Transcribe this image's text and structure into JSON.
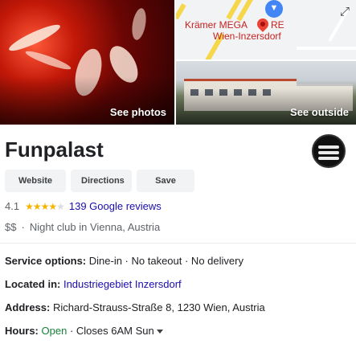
{
  "hero": {
    "photos_label": "See photos",
    "outside_label": "See outside",
    "map_labels": [
      "Krämer MEGA",
      "RE",
      "Wien-Inzersdorf"
    ],
    "map_pin_icon": "map-pin-icon",
    "map_expand_icon": "expand-icon"
  },
  "place": {
    "name": "Funpalast",
    "avatar_icon": "business-logo"
  },
  "actions": {
    "website": "Website",
    "directions": "Directions",
    "save": "Save"
  },
  "rating": {
    "score": "4.1",
    "stars_filled": 4,
    "stars_total": 5,
    "reviews_text": "139 Google reviews"
  },
  "category": {
    "price": "$$",
    "separator": "·",
    "text": "Night club in Vienna, Austria"
  },
  "details": {
    "service_label": "Service options:",
    "service_value": "Dine-in · No takeout · No delivery",
    "located_label": "Located in:",
    "located_value": "Industriegebiet Inzersdorf",
    "address_label": "Address:",
    "address_value": "Richard-Strauss-Straße 8, 1230 Wien, Austria",
    "hours_label": "Hours:",
    "hours_status": "Open",
    "hours_detail": "· Closes 6AM Sun"
  },
  "colors": {
    "link": "#1a0dab",
    "open": "#188038",
    "star": "#f4b400",
    "map_label": "#c5221f"
  }
}
